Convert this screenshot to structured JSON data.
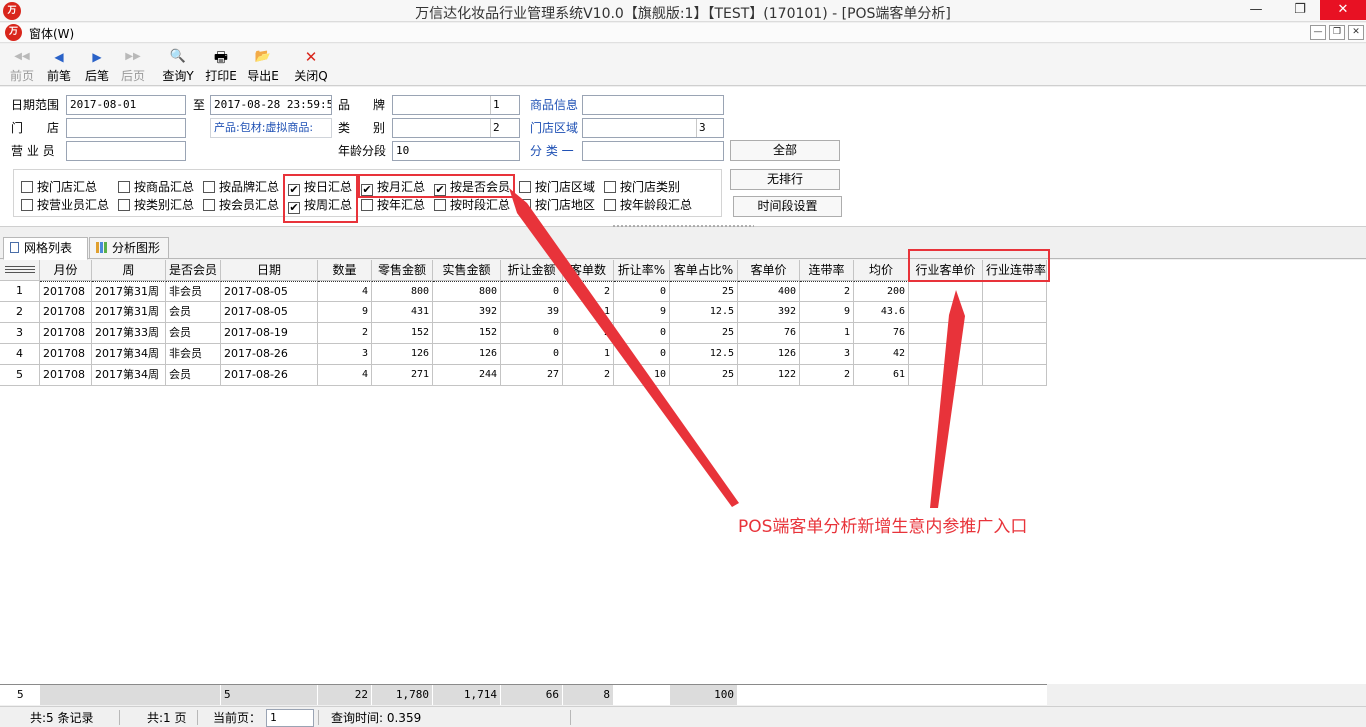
{
  "window": {
    "title": "万信达化妆品行业管理系统V10.0【旗舰版:1】【TEST】(170101) - [POS端客单分析]",
    "logo_text": "万",
    "minimize": "—",
    "restore": "❐",
    "close": "✕"
  },
  "menu": {
    "item": "窗体(W)"
  },
  "mdi": {
    "minimize": "—",
    "restore": "❐",
    "close": "✕"
  },
  "toolbar": {
    "first": {
      "icon": "◀◀",
      "label": "前页",
      "disabled": true
    },
    "prev": {
      "icon": "◀",
      "label": "前笔",
      "disabled": false
    },
    "next": {
      "icon": "▶",
      "label": "后笔",
      "disabled": false
    },
    "last": {
      "icon": "▶▶",
      "label": "后页",
      "disabled": true
    },
    "query": {
      "icon": "🔍",
      "label": "查询Y"
    },
    "print": {
      "icon": "🖶",
      "label": "打印E"
    },
    "export": {
      "icon": "📂",
      "label": "导出E"
    },
    "close": {
      "icon": "✕",
      "label": "关闭Q"
    }
  },
  "filter": {
    "date_range_label": "日期范围",
    "date_from": "2017-08-01",
    "to_label": "至",
    "date_to": "2017-08-28 23:59:59",
    "brand_label_1": "品",
    "brand_label_2": "牌",
    "brand_suffix": "1",
    "product_info_label": "商品信息",
    "store_label_1": "门",
    "store_label_2": "店",
    "product_scope": "产品:包材:虚拟商品:",
    "category_label_1": "类",
    "category_label_2": "别",
    "category_suffix": "2",
    "store_area_label": "门店区域",
    "store_area_suffix": "3",
    "salesperson_label": "营 业 员",
    "age_group_label": "年龄分段",
    "age_group_value": "10",
    "classify_label": "分 类 一",
    "btn_all": "全部",
    "btn_no_rank": "无排行",
    "btn_time_setting": "时间段设置"
  },
  "checkboxes": {
    "by_store": {
      "label": "按门店汇总",
      "checked": false
    },
    "by_product": {
      "label": "按商品汇总",
      "checked": false
    },
    "by_brand": {
      "label": "按品牌汇总",
      "checked": false
    },
    "by_day": {
      "label": "按日汇总",
      "checked": true
    },
    "by_month": {
      "label": "按月汇总",
      "checked": true
    },
    "by_member": {
      "label": "按是否会员",
      "checked": true
    },
    "by_store_area": {
      "label": "按门店区域",
      "checked": false
    },
    "by_store_type": {
      "label": "按门店类别",
      "checked": false
    },
    "by_salesperson": {
      "label": "按营业员汇总",
      "checked": false
    },
    "by_category": {
      "label": "按类别汇总",
      "checked": false
    },
    "by_membership": {
      "label": "按会员汇总",
      "checked": false
    },
    "by_week": {
      "label": "按周汇总",
      "checked": true
    },
    "by_year": {
      "label": "按年汇总",
      "checked": false
    },
    "by_timeslot": {
      "label": "按时段汇总",
      "checked": false
    },
    "by_store_region": {
      "label": "按门店地区",
      "checked": false
    },
    "by_age_group": {
      "label": "按年龄段汇总",
      "checked": false
    }
  },
  "tabs": {
    "grid": "网格列表",
    "chart": "分析图形"
  },
  "grid": {
    "headers": [
      "月份",
      "周",
      "是否会员",
      "日期",
      "数量",
      "零售金额",
      "实售金额",
      "折让金额",
      "客单数",
      "折让率%",
      "客单占比%",
      "客单价",
      "连带率",
      "均价",
      "行业客单价",
      "行业连带率"
    ],
    "rows": [
      {
        "no": "1",
        "month": "201708",
        "week": "2017第31周",
        "member": "非会员",
        "date": "2017-08-05",
        "qty": "4",
        "retail": "800",
        "actual": "800",
        "discount": "0",
        "orders": "2",
        "disc_rate": "0",
        "order_pct": "25",
        "aov": "400",
        "upt": "2",
        "avg": "200",
        "ind_aov": "",
        "ind_upt": ""
      },
      {
        "no": "2",
        "month": "201708",
        "week": "2017第31周",
        "member": "会员",
        "date": "2017-08-05",
        "qty": "9",
        "retail": "431",
        "actual": "392",
        "discount": "39",
        "orders": "1",
        "disc_rate": "9",
        "order_pct": "12.5",
        "aov": "392",
        "upt": "9",
        "avg": "43.6",
        "ind_aov": "",
        "ind_upt": ""
      },
      {
        "no": "3",
        "month": "201708",
        "week": "2017第33周",
        "member": "会员",
        "date": "2017-08-19",
        "qty": "2",
        "retail": "152",
        "actual": "152",
        "discount": "0",
        "orders": "2",
        "disc_rate": "0",
        "order_pct": "25",
        "aov": "76",
        "upt": "1",
        "avg": "76",
        "ind_aov": "",
        "ind_upt": ""
      },
      {
        "no": "4",
        "month": "201708",
        "week": "2017第34周",
        "member": "非会员",
        "date": "2017-08-26",
        "qty": "3",
        "retail": "126",
        "actual": "126",
        "discount": "0",
        "orders": "1",
        "disc_rate": "0",
        "order_pct": "12.5",
        "aov": "126",
        "upt": "3",
        "avg": "42",
        "ind_aov": "",
        "ind_upt": ""
      },
      {
        "no": "5",
        "month": "201708",
        "week": "2017第34周",
        "member": "会员",
        "date": "2017-08-26",
        "qty": "4",
        "retail": "271",
        "actual": "244",
        "discount": "27",
        "orders": "2",
        "disc_rate": "10",
        "order_pct": "25",
        "aov": "122",
        "upt": "2",
        "avg": "61",
        "ind_aov": "",
        "ind_upt": ""
      }
    ]
  },
  "totals": {
    "count": "5",
    "dates": "5",
    "qty": "22",
    "retail": "1,780",
    "actual": "1,714",
    "discount": "66",
    "orders": "8",
    "order_pct": "100"
  },
  "status": {
    "records": "共:5 条记录",
    "pages": "共:1 页",
    "current_page_label": "当前页：",
    "current_page": "1",
    "query_time": "查询时间: 0.359"
  },
  "annotation": {
    "text": "POS端客单分析新增生意内参推广入口",
    "color": "#e8333a"
  },
  "colors": {
    "accent": "#e8333a",
    "link": "#1e50b4",
    "logo": "#d9261c",
    "close_button": "#e81123"
  }
}
